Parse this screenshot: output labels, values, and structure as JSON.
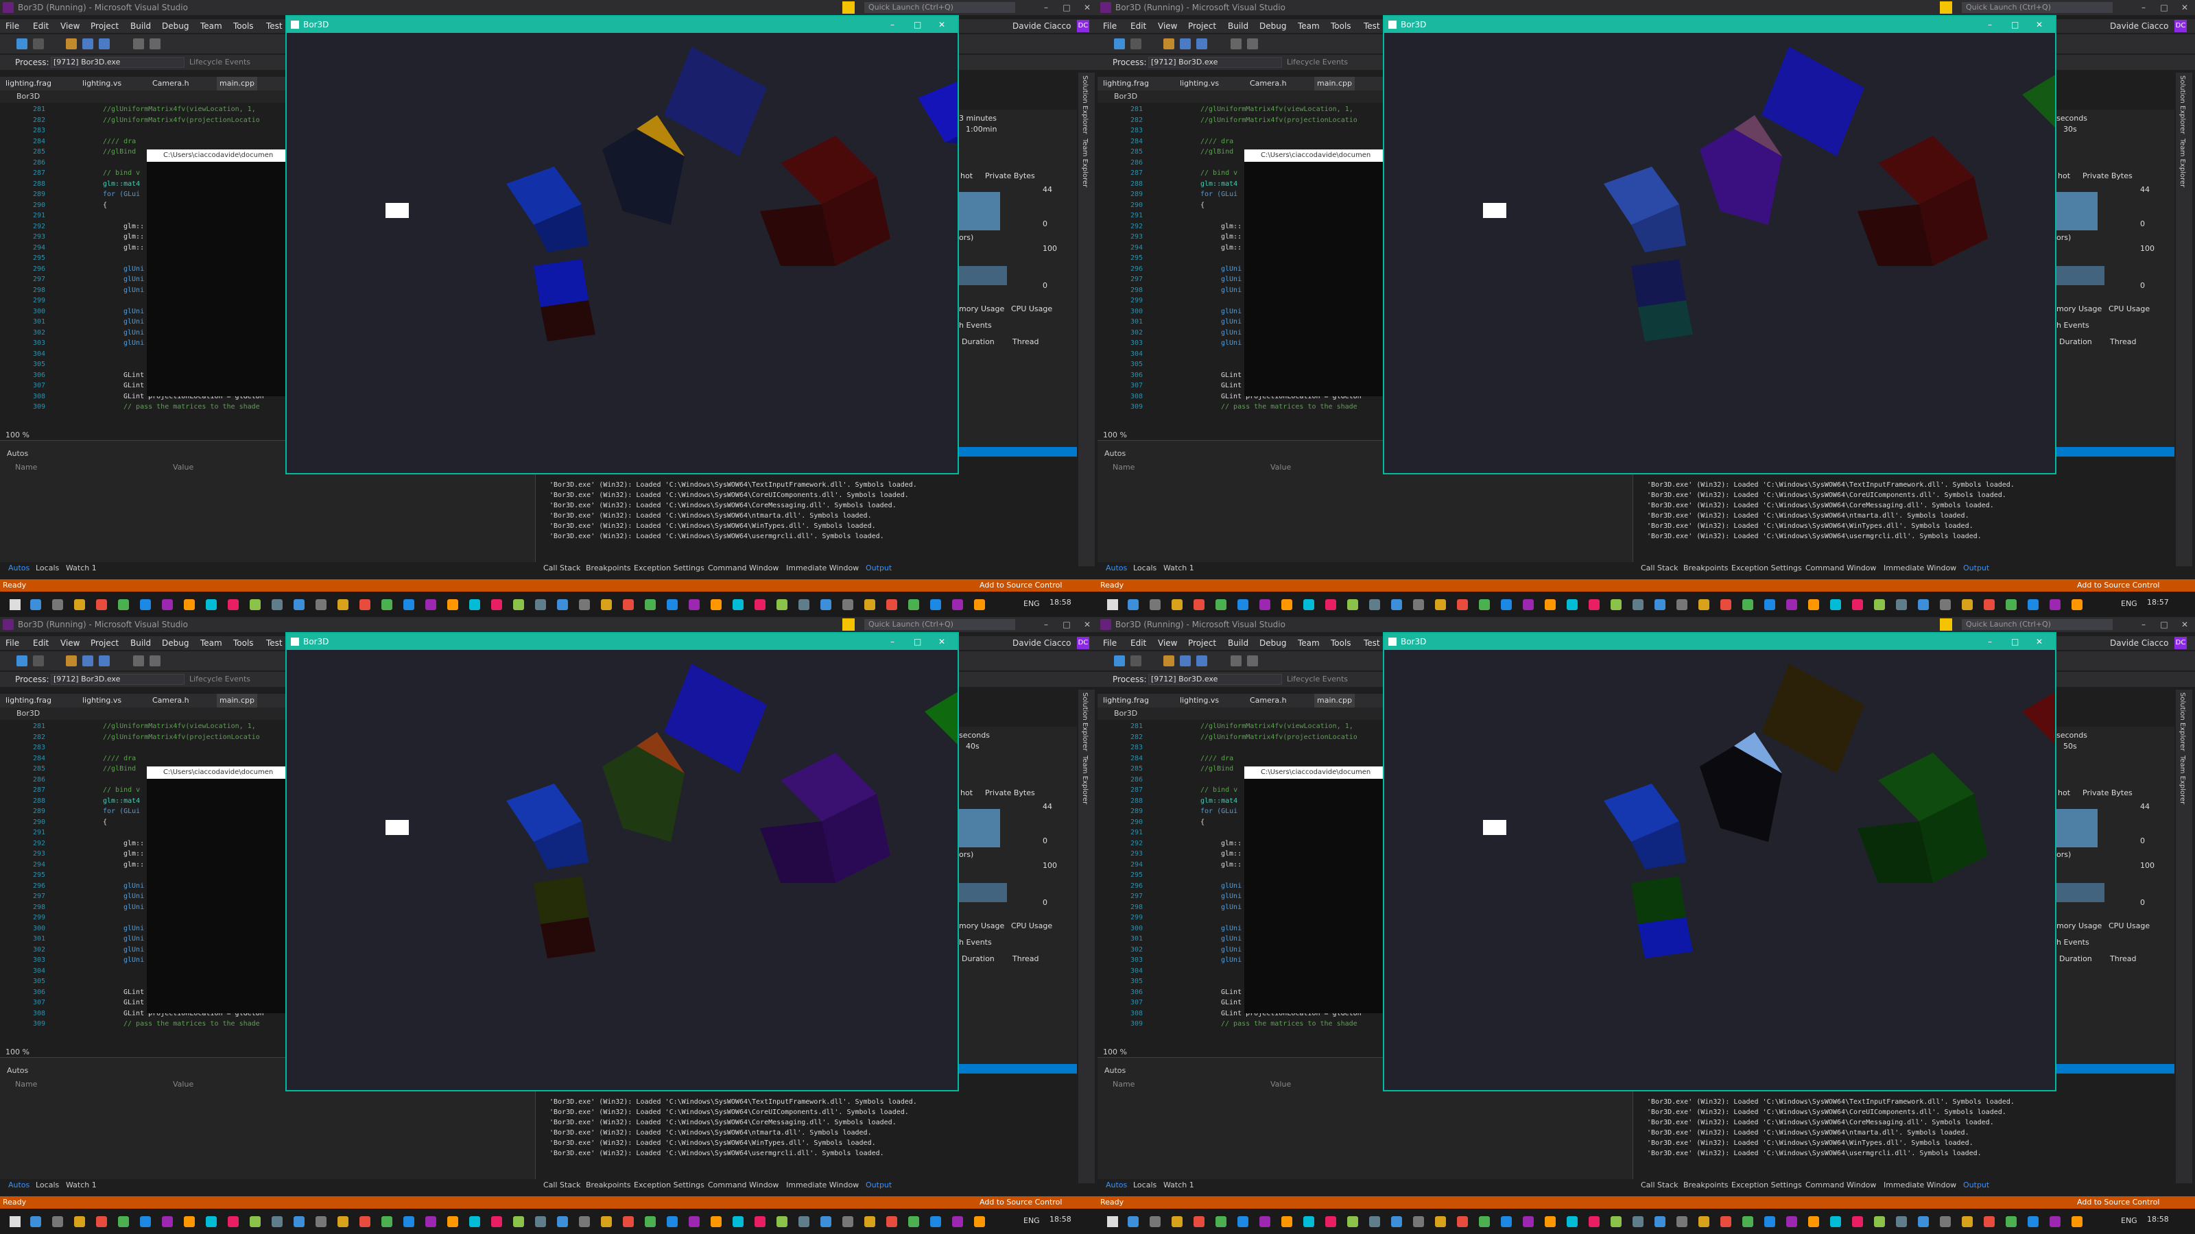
{
  "vs": {
    "title": "Bor3D (Running) - Microsoft Visual Studio",
    "quick_launch": "Quick Launch (Ctrl+Q)",
    "menu": [
      "File",
      "Edit",
      "View",
      "Project",
      "Build",
      "Debug",
      "Team",
      "Tools",
      "Test"
    ],
    "user": "Davide Ciacco",
    "user_initials": "DC",
    "process_label": "Process:",
    "process_value": "[9712] Bor3D.exe",
    "lifecycle": "Lifecycle Events",
    "tabs": [
      "lighting.frag",
      "lighting.vs",
      "Camera.h",
      "main.cpp"
    ],
    "file_header": "Bor3D",
    "zoom": "100 %",
    "autos_title": "Autos",
    "autos_cols": [
      "Name",
      "Value"
    ],
    "autos_tabs": [
      "Autos",
      "Locals",
      "Watch 1"
    ],
    "output_tabs": [
      "Call Stack",
      "Breakpoints",
      "Exception Settings",
      "Command Window",
      "Immediate Window",
      "Output"
    ],
    "console_path": "C:\\Users\\ciaccodavide\\documen",
    "status_ready": "Ready",
    "add_source": "Add to Source Control",
    "lang": "ENG",
    "diag": {
      "snapshot": "hot",
      "private_bytes": "Private Bytes",
      "v44": "44",
      "v0a": "0",
      "v100": "100",
      "v0b": "0",
      "ors": "ors)",
      "memory": "mory Usage",
      "cpu": "CPU Usage",
      "events": "h Events",
      "duration": "Duration",
      "thread": "Thread"
    },
    "right_strip": [
      "Solution Explorer",
      "Team Explorer"
    ]
  },
  "code_lines": [
    {
      "n": "281",
      "t": "//glUniformMatrix4fv(viewLocation, 1,",
      "cls": "c-comment",
      "ind": 0
    },
    {
      "n": "282",
      "t": "//glUniformMatrix4fv(projectionLocatio",
      "cls": "c-comment",
      "ind": 0
    },
    {
      "n": "283",
      "t": "",
      "cls": "c-plain",
      "ind": 0
    },
    {
      "n": "284",
      "t": "//// dra",
      "cls": "c-comment",
      "ind": 0
    },
    {
      "n": "285",
      "t": "//glBind",
      "cls": "c-comment",
      "ind": 0
    },
    {
      "n": "286",
      "t": "",
      "cls": "c-plain",
      "ind": 0
    },
    {
      "n": "287",
      "t": "// bind v",
      "cls": "c-comment",
      "ind": 0
    },
    {
      "n": "288",
      "t": "glm::mat4",
      "cls": "c-type",
      "ind": 0
    },
    {
      "n": "289",
      "t": "for (GLui",
      "cls": "c-kw",
      "ind": 0
    },
    {
      "n": "290",
      "t": "{",
      "cls": "c-plain",
      "ind": 0
    },
    {
      "n": "291",
      "t": "",
      "cls": "c-plain",
      "ind": 0
    },
    {
      "n": "292",
      "t": "glm::",
      "cls": "c-plain",
      "ind": 1
    },
    {
      "n": "293",
      "t": "glm::",
      "cls": "c-plain",
      "ind": 1
    },
    {
      "n": "294",
      "t": "glm::",
      "cls": "c-plain",
      "ind": 1
    },
    {
      "n": "295",
      "t": "",
      "cls": "c-plain",
      "ind": 0
    },
    {
      "n": "296",
      "t": "glUni",
      "cls": "c-kw",
      "ind": 1
    },
    {
      "n": "297",
      "t": "glUni",
      "cls": "c-kw",
      "ind": 1
    },
    {
      "n": "298",
      "t": "glUni",
      "cls": "c-kw",
      "ind": 1
    },
    {
      "n": "299",
      "t": "",
      "cls": "c-plain",
      "ind": 0
    },
    {
      "n": "300",
      "t": "glUni",
      "cls": "c-kw",
      "ind": 1
    },
    {
      "n": "301",
      "t": "glUni",
      "cls": "c-kw",
      "ind": 1
    },
    {
      "n": "302",
      "t": "glUni",
      "cls": "c-kw",
      "ind": 1
    },
    {
      "n": "303",
      "t": "glUni",
      "cls": "c-kw",
      "ind": 1
    },
    {
      "n": "304",
      "t": "",
      "cls": "c-plain",
      "ind": 0
    },
    {
      "n": "305",
      "t": "",
      "cls": "c-plain",
      "ind": 0
    },
    {
      "n": "306",
      "t": "GLint modelLocation = glGetUnifor",
      "cls": "c-plain",
      "ind": 1
    },
    {
      "n": "307",
      "t": "GLint viewLocation = glGetUniform",
      "cls": "c-plain",
      "ind": 1
    },
    {
      "n": "308",
      "t": "GLint projectionLocation = glGetUn",
      "cls": "c-plain",
      "ind": 1
    },
    {
      "n": "309",
      "t": "// pass the matrices to the shade",
      "cls": "c-comment",
      "ind": 1
    }
  ],
  "output_lines": [
    "'Bor3D.exe' (Win32): Loaded 'C:\\Windows\\SysWOW64\\TextInputFramework.dll'. Symbols loaded.",
    "'Bor3D.exe' (Win32): Loaded 'C:\\Windows\\SysWOW64\\CoreUIComponents.dll'. Symbols loaded.",
    "'Bor3D.exe' (Win32): Loaded 'C:\\Windows\\SysWOW64\\CoreMessaging.dll'. Symbols loaded.",
    "'Bor3D.exe' (Win32): Loaded 'C:\\Windows\\SysWOW64\\ntmarta.dll'. Symbols loaded.",
    "'Bor3D.exe' (Win32): Loaded 'C:\\Windows\\SysWOW64\\WinTypes.dll'. Symbols loaded.",
    "'Bor3D.exe' (Win32): Loaded 'C:\\Windows\\SysWOW64\\usermgrcli.dll'. Symbols loaded."
  ],
  "panes": [
    {
      "gl_title": "Bor3D",
      "clock": "18:58",
      "diag_unit": "3 minutes",
      "diag_timer": "1:00min"
    },
    {
      "gl_title": "Bor3D",
      "clock": "18:57",
      "diag_unit": "seconds",
      "diag_timer": "30s"
    },
    {
      "gl_title": "Bor3D",
      "clock": "18:58",
      "diag_unit": "seconds",
      "diag_timer": "40s"
    },
    {
      "gl_title": "Bor3D",
      "clock": "18:58",
      "diag_unit": "seconds",
      "diag_timer": "50s"
    }
  ],
  "colors": {
    "vs_status": "#ca5100",
    "gl_border": "#00bba0",
    "gl_bg": "#21222b",
    "vs_accent": "#007acc"
  }
}
